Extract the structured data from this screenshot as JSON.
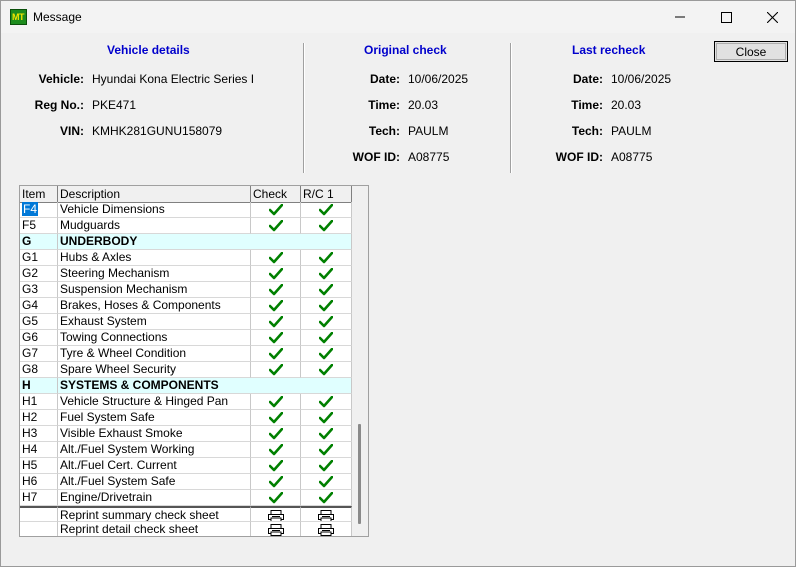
{
  "window": {
    "title": "Message",
    "app_icon_text": "MT"
  },
  "buttons": {
    "close_label": "Close"
  },
  "vehicle": {
    "heading": "Vehicle details",
    "vehicle_label": "Vehicle:",
    "vehicle_value": "Hyundai Kona Electric Series I",
    "reg_label": "Reg No.:",
    "reg_value": "PKE471",
    "vin_label": "VIN:",
    "vin_value": "KMHK281GUNU158079"
  },
  "original": {
    "heading": "Original check",
    "date_label": "Date:",
    "date_value": "10/06/2025",
    "time_label": "Time:",
    "time_value": "20.03",
    "tech_label": "Tech:",
    "tech_value": "PAULM",
    "wof_label": "WOF ID:",
    "wof_value": "A08775"
  },
  "recheck": {
    "heading": "Last recheck",
    "date_label": "Date:",
    "date_value": "10/06/2025",
    "time_label": "Time:",
    "time_value": "20.03",
    "tech_label": "Tech:",
    "tech_value": "PAULM",
    "wof_label": "WOF ID:",
    "wof_value": "A08775"
  },
  "grid": {
    "columns": [
      "Item",
      "Description",
      "Check",
      "R/C 1"
    ],
    "check_color": "#008000",
    "rows": [
      {
        "item": "F4",
        "desc": "Vehicle Dimensions",
        "check": true,
        "rc": true,
        "selected": true
      },
      {
        "item": "F5",
        "desc": "Mudguards",
        "check": true,
        "rc": true
      },
      {
        "item": "G",
        "desc": "UNDERBODY",
        "section": true
      },
      {
        "item": "G1",
        "desc": "Hubs & Axles",
        "check": true,
        "rc": true
      },
      {
        "item": "G2",
        "desc": "Steering Mechanism",
        "check": true,
        "rc": true
      },
      {
        "item": "G3",
        "desc": "Suspension Mechanism",
        "check": true,
        "rc": true
      },
      {
        "item": "G4",
        "desc": "Brakes, Hoses & Components",
        "check": true,
        "rc": true
      },
      {
        "item": "G5",
        "desc": "Exhaust System",
        "check": true,
        "rc": true
      },
      {
        "item": "G6",
        "desc": "Towing Connections",
        "check": true,
        "rc": true
      },
      {
        "item": "G7",
        "desc": "Tyre & Wheel Condition",
        "check": true,
        "rc": true
      },
      {
        "item": "G8",
        "desc": "Spare Wheel Security",
        "check": true,
        "rc": true
      },
      {
        "item": "H",
        "desc": "SYSTEMS & COMPONENTS",
        "section": true
      },
      {
        "item": "H1",
        "desc": "Vehicle Structure & Hinged Pan",
        "check": true,
        "rc": true
      },
      {
        "item": "H2",
        "desc": "Fuel System Safe",
        "check": true,
        "rc": true
      },
      {
        "item": "H3",
        "desc": "Visible Exhaust Smoke",
        "check": true,
        "rc": true
      },
      {
        "item": "H4",
        "desc": "Alt./Fuel System Working",
        "check": true,
        "rc": true
      },
      {
        "item": "H5",
        "desc": "Alt./Fuel Cert. Current",
        "check": true,
        "rc": true
      },
      {
        "item": "H6",
        "desc": "Alt./Fuel System Safe",
        "check": true,
        "rc": true
      },
      {
        "item": "H7",
        "desc": "Engine/Drivetrain",
        "check": true,
        "rc": true
      },
      {
        "item": "",
        "desc": "Reprint summary check sheet",
        "print": true
      },
      {
        "item": "",
        "desc": "Reprint detail check sheet",
        "print": true
      }
    ]
  }
}
